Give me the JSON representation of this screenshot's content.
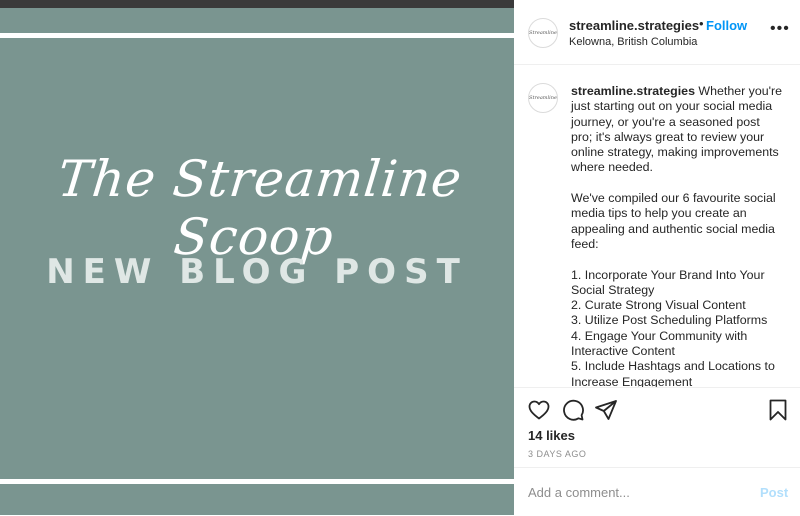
{
  "image": {
    "script_title": "The Streamline Scoop",
    "subtitle": "NEW BLOG POST"
  },
  "header": {
    "avatar_text": "Streamline",
    "username": "streamline.strategies",
    "separator": "•",
    "follow_label": "Follow",
    "location": "Kelowna, British Columbia",
    "more_label": "•••"
  },
  "caption": {
    "avatar_text": "Streamline",
    "username": "streamline.strategies",
    "body": " Whether you're just starting out on your social media journey, or you're a seasoned post pro; it's always great to review your online strategy, making improvements where needed.\n\nWe've compiled our 6 favourite social media tips to help you create an appealing and authentic social media feed:\n\n1. Incorporate Your Brand Into Your Social Strategy\n2. Curate Strong Visual Content\n3. Utilize Post Scheduling Platforms\n4. Engage Your Community with Interactive Content\n5. Include Hashtags and Locations to Increase Engagement"
  },
  "actions": {
    "icons": [
      "heart-icon",
      "comment-icon",
      "share-icon",
      "bookmark-icon"
    ],
    "likes": "14 likes",
    "timestamp": "3 DAYS AGO"
  },
  "comment": {
    "placeholder": "Add a comment...",
    "post_label": "Post"
  },
  "colors": {
    "image_bg": "#7a9590",
    "follow": "#0095f6",
    "post_disabled": "#b2dffc"
  }
}
